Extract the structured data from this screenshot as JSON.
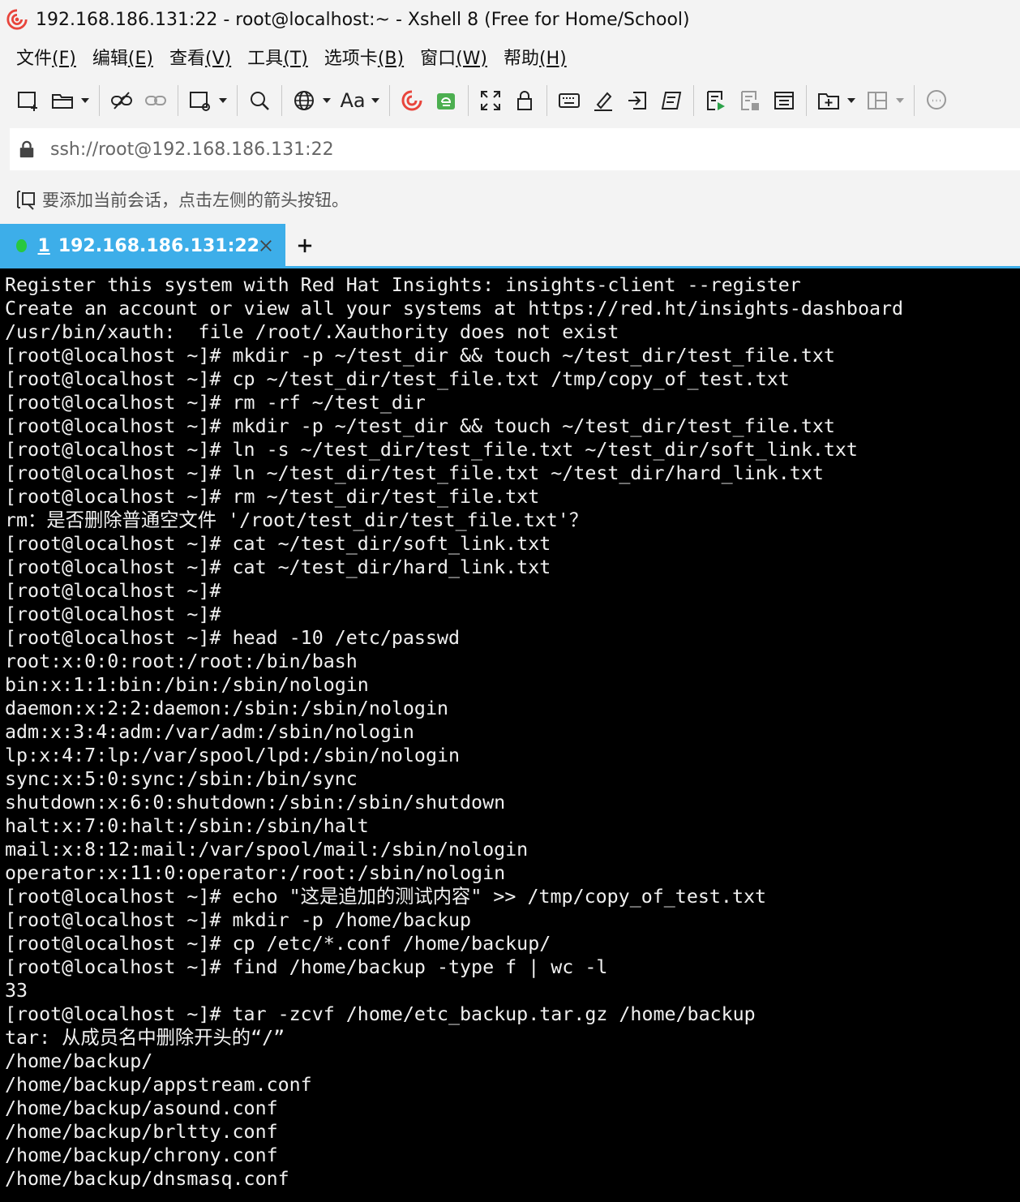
{
  "window": {
    "title": "192.168.186.131:22 - root@localhost:~ - Xshell 8 (Free for Home/School)"
  },
  "menu": {
    "items": [
      {
        "label": "文件",
        "accel": "(F)"
      },
      {
        "label": "编辑",
        "accel": "(E)"
      },
      {
        "label": "查看",
        "accel": "(V)"
      },
      {
        "label": "工具",
        "accel": "(T)"
      },
      {
        "label": "选项卡",
        "accel": "(B)"
      },
      {
        "label": "窗口",
        "accel": "(W)"
      },
      {
        "label": "帮助",
        "accel": "(H)"
      }
    ]
  },
  "toolbar": {
    "font_button_label": "Aa",
    "icons": [
      "new-session-icon",
      "open-folder-icon",
      "disconnect-icon",
      "link-icon",
      "new-window-icon",
      "search-icon",
      "globe-icon",
      "font-icon",
      "xshell-icon",
      "xftp-icon",
      "fullscreen-icon",
      "lock-icon",
      "keyboard-icon",
      "highlight-icon",
      "send-icon",
      "script-icon",
      "start-log-icon",
      "stop-log-icon",
      "log-file-icon",
      "new-folder-icon",
      "layout-icon",
      "chat-icon"
    ]
  },
  "address": {
    "value": "ssh://root@192.168.186.131:22"
  },
  "hint": {
    "text": "要添加当前会话，点击左侧的箭头按钮。"
  },
  "tabs": [
    {
      "number": "1",
      "label": "192.168.186.131:22",
      "status_color": "#28c840",
      "active": true
    }
  ],
  "colors": {
    "tab_active": "#3daee9",
    "terminal_bg": "#000000",
    "terminal_fg": "#f0f0f0"
  },
  "terminal": {
    "lines": [
      "Register this system with Red Hat Insights: insights-client --register",
      "Create an account or view all your systems at https://red.ht/insights-dashboard",
      "/usr/bin/xauth:  file /root/.Xauthority does not exist",
      "[root@localhost ~]# mkdir -p ~/test_dir && touch ~/test_dir/test_file.txt",
      "[root@localhost ~]# cp ~/test_dir/test_file.txt /tmp/copy_of_test.txt",
      "[root@localhost ~]# rm -rf ~/test_dir",
      "[root@localhost ~]# mkdir -p ~/test_dir && touch ~/test_dir/test_file.txt",
      "[root@localhost ~]# ln -s ~/test_dir/test_file.txt ~/test_dir/soft_link.txt",
      "[root@localhost ~]# ln ~/test_dir/test_file.txt ~/test_dir/hard_link.txt",
      "[root@localhost ~]# rm ~/test_dir/test_file.txt",
      "rm：是否删除普通空文件 '/root/test_dir/test_file.txt'？",
      "[root@localhost ~]# cat ~/test_dir/soft_link.txt",
      "[root@localhost ~]# cat ~/test_dir/hard_link.txt",
      "[root@localhost ~]#",
      "[root@localhost ~]#",
      "[root@localhost ~]# head -10 /etc/passwd",
      "root:x:0:0:root:/root:/bin/bash",
      "bin:x:1:1:bin:/bin:/sbin/nologin",
      "daemon:x:2:2:daemon:/sbin:/sbin/nologin",
      "adm:x:3:4:adm:/var/adm:/sbin/nologin",
      "lp:x:4:7:lp:/var/spool/lpd:/sbin/nologin",
      "sync:x:5:0:sync:/sbin:/bin/sync",
      "shutdown:x:6:0:shutdown:/sbin:/sbin/shutdown",
      "halt:x:7:0:halt:/sbin:/sbin/halt",
      "mail:x:8:12:mail:/var/spool/mail:/sbin/nologin",
      "operator:x:11:0:operator:/root:/sbin/nologin",
      "[root@localhost ~]# echo \"这是追加的测试内容\" >> /tmp/copy_of_test.txt",
      "[root@localhost ~]# mkdir -p /home/backup",
      "[root@localhost ~]# cp /etc/*.conf /home/backup/",
      "[root@localhost ~]# find /home/backup -type f | wc -l",
      "33",
      "[root@localhost ~]# tar -zcvf /home/etc_backup.tar.gz /home/backup",
      "tar: 从成员名中删除开头的“/”",
      "/home/backup/",
      "/home/backup/appstream.conf",
      "/home/backup/asound.conf",
      "/home/backup/brltty.conf",
      "/home/backup/chrony.conf",
      "/home/backup/dnsmasq.conf"
    ]
  }
}
